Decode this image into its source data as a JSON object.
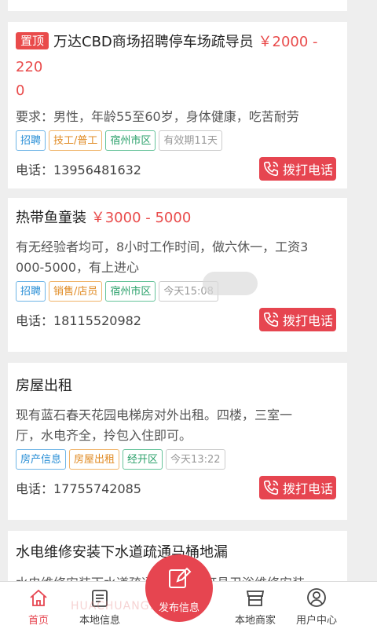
{
  "listings": [
    {
      "pinned_label": "置顶",
      "title": "万达CBD商场招聘停车场疏导员",
      "salary_line1": "￥2000 - 220",
      "salary_line2": "0",
      "desc": "要求：男性，年龄55至60岁，身体健康，吃苦耐劳",
      "tags": [
        "招聘",
        "技工/普工",
        "宿州市区",
        "有效期11天"
      ],
      "phone": "电话：13956481632",
      "call_label": "拨打电话"
    },
    {
      "title": "热带鱼童装",
      "salary": "￥3000 - 5000",
      "desc_line1": "有无经验者均可，8小时工作时间，做六休一，工资3",
      "desc_line2": "000-5000，有上进心",
      "tags": [
        "招聘",
        "销售/店员",
        "宿州市区",
        "今天15:08"
      ],
      "phone": "电话：18115520982",
      "call_label": "拨打电话"
    },
    {
      "title": "房屋出租",
      "desc_line1": "现有蓝石春天花园电梯房对外出租。四楼，三室一",
      "desc_line2": "厅，水电齐全，拎包入住即可。",
      "tags": [
        "房产信息",
        "房屋出租",
        "经开区",
        "今天13:22"
      ],
      "phone": "电话：17755742085",
      "call_label": "拨打电话"
    },
    {
      "title": "水电维修安装下水道疏通马桶地漏",
      "desc_line1": "水电维修安装下水道疏通马桶地漏灯具卫浴维修安装"
    }
  ],
  "tabbar": {
    "home": "首页",
    "local_info": "本地信息",
    "publish": "发布信息",
    "merchants": "本地商家",
    "user_center": "用户中心"
  },
  "colors": {
    "accent": "#e64550"
  }
}
